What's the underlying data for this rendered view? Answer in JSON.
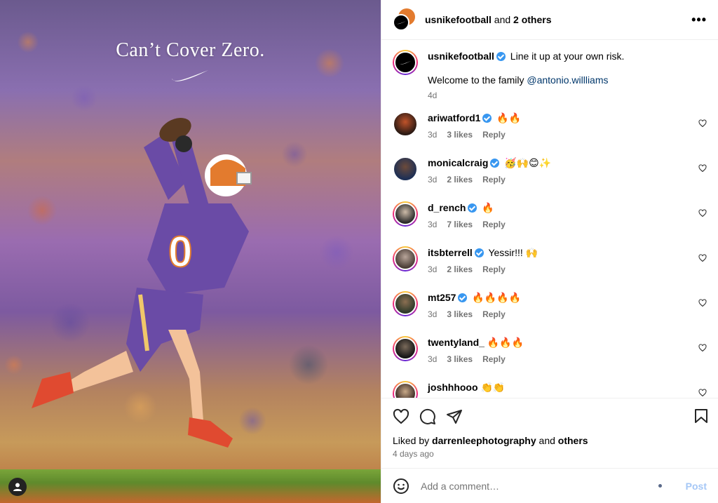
{
  "photo": {
    "tagline": "Can’t Cover Zero.",
    "jersey_number": "0"
  },
  "header": {
    "account": "usnikefootball",
    "and_text": "and",
    "others": "2 others",
    "more": "•••"
  },
  "caption": {
    "username": "usnikefootball",
    "line1": "Line it up at your own risk.",
    "line2_prefix": "Welcome to the family",
    "mention": "@antonio.willliams",
    "time": "4d"
  },
  "comments": [
    {
      "username": "ariwatford1",
      "text": "🔥🔥",
      "time": "3d",
      "likes": "3 likes",
      "reply": "Reply"
    },
    {
      "username": "monicalcraig",
      "text": "🥳🙌😊✨",
      "time": "3d",
      "likes": "2 likes",
      "reply": "Reply"
    },
    {
      "username": "d_rench",
      "text": "🔥",
      "time": "3d",
      "likes": "7 likes",
      "reply": "Reply"
    },
    {
      "username": "itsbterrell",
      "text": "Yessir!!! 🙌",
      "time": "3d",
      "likes": "2 likes",
      "reply": "Reply"
    },
    {
      "username": "mt257",
      "text": "🔥🔥🔥🔥",
      "time": "3d",
      "likes": "3 likes",
      "reply": "Reply"
    },
    {
      "username": "twentyland_",
      "text": "🔥🔥🔥",
      "time": "3d",
      "likes": "3 likes",
      "reply": "Reply"
    },
    {
      "username": "joshhhooo",
      "text": "👏👏",
      "time": "",
      "likes": "",
      "reply": ""
    }
  ],
  "actions": {
    "liked_by_prefix": "Liked by",
    "liked_by_user": "darrenleephotography",
    "and_text": "and",
    "others": "others",
    "ago": "4 days ago"
  },
  "add_comment": {
    "placeholder": "Add a comment…",
    "post_label": "Post"
  },
  "colors": {
    "verified": "#3897f0",
    "link": "#00376b",
    "post_disabled": "#a5c7f6",
    "clemson_purple": "#6a4ba6",
    "clemson_orange": "#e37b2e"
  }
}
